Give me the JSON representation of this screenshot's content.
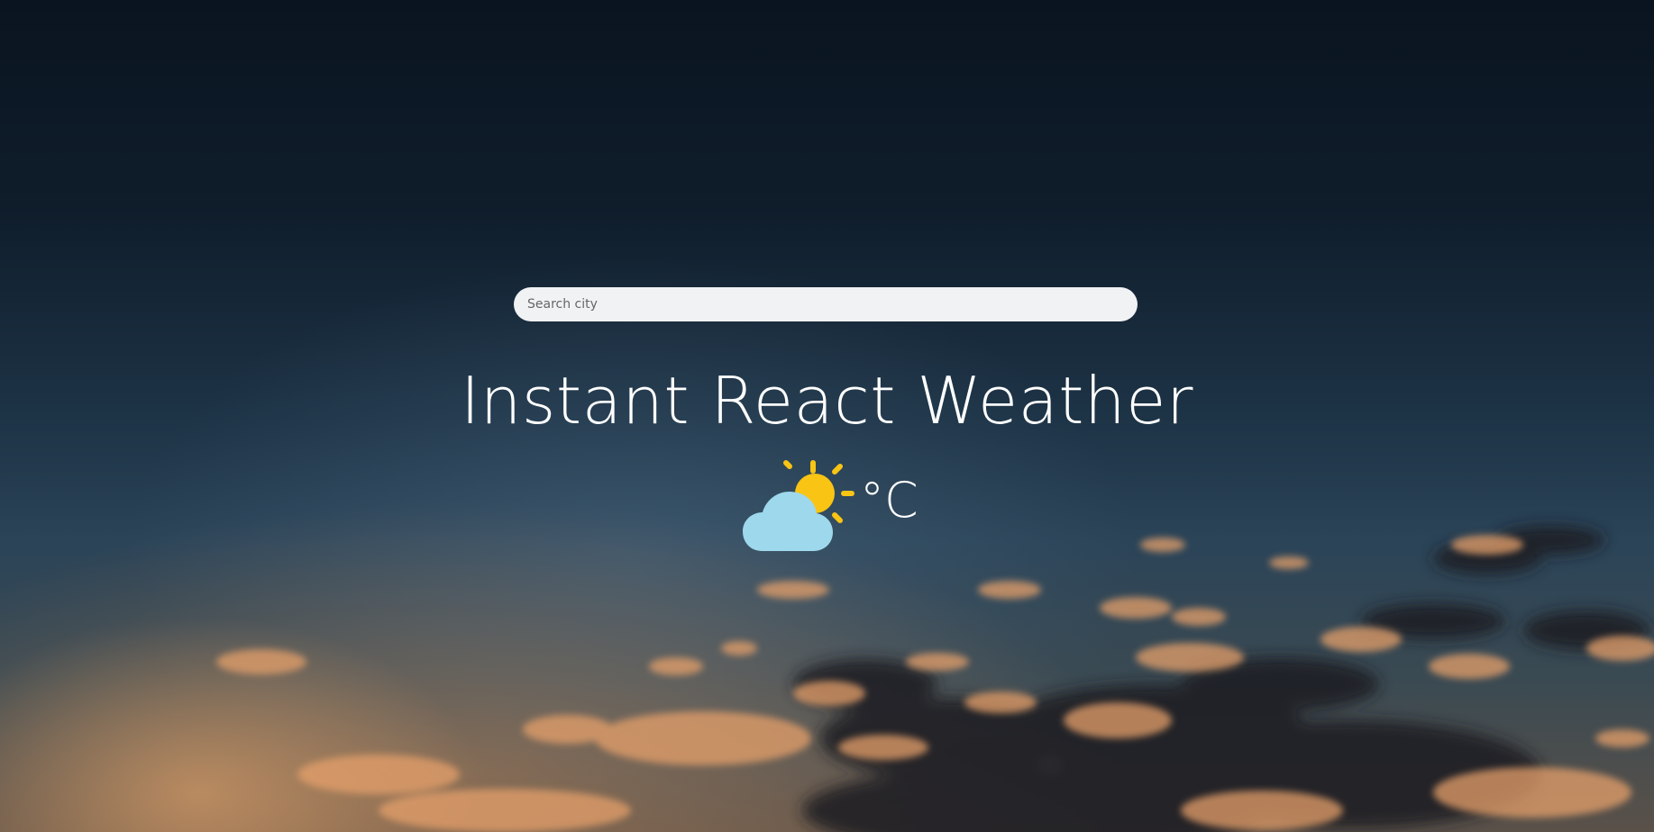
{
  "search": {
    "placeholder": "Search city",
    "value": ""
  },
  "header": {
    "title": "Instant React Weather"
  },
  "weather": {
    "icon": "partly-cloudy-icon",
    "temperature": "",
    "unit": "°C"
  },
  "colors": {
    "sun": "#f9c413",
    "cloud": "#9ed8ec",
    "title_text": "#ffffff",
    "search_bg": "#f1f2f4"
  }
}
